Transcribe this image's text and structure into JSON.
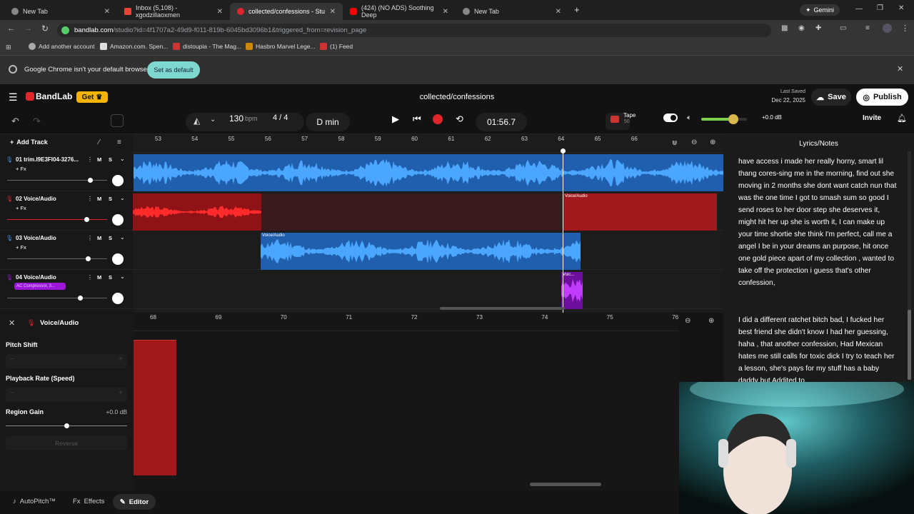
{
  "browser": {
    "tabs": [
      {
        "label": "New Tab",
        "active": false
      },
      {
        "label": "Inbox (5,108) - xgodzillaoxmen",
        "active": false
      },
      {
        "label": "collected/confessions - Stu",
        "active": true
      },
      {
        "label": "(424) (NO ADS) Soothing Deep",
        "active": false
      },
      {
        "label": "New Tab",
        "active": false
      }
    ],
    "gemini_label": "Gemini",
    "url_host": "bandlab.com",
    "url_path": "/studio?id=4f1707a2-49d9-f011-819b-6045bd3096b1&triggered_from=revision_page",
    "bookmarks": [
      "Add another account",
      "Amazon.com. Spen...",
      "distoupia - The Mag...",
      "Hasbro Marvel Lege...",
      "(1) Feed"
    ],
    "infobar_text": "Google Chrome isn't your default browser",
    "set_default_label": "Set as default"
  },
  "header": {
    "logo": "BandLab",
    "get_label": "Get",
    "project_title": "collected/confessions",
    "last_saved_label": "Last Saved",
    "last_saved_date": "Dec 22, 2025",
    "save_label": "Save",
    "publish_label": "Publish"
  },
  "controls": {
    "bpm_value": "130",
    "bpm_unit": "bpm",
    "time_signature": "4 / 4",
    "key": "D min",
    "time_display": "01:56.7",
    "tape_label": "Tape",
    "tape_sub": "50",
    "volume_db": "+0.0 dB",
    "volume_level": 0.7,
    "invite_label": "Invite"
  },
  "tracks_panel": {
    "add_track_label": "Add Track",
    "ruler": [
      "53",
      "54",
      "55",
      "56",
      "57",
      "58",
      "59",
      "60",
      "61",
      "62",
      "63",
      "64",
      "65",
      "66"
    ],
    "tracks": [
      {
        "name": "01  trim.I9E3FI04-3276...",
        "fx": "+ Fx",
        "color": "#3b8ee8",
        "volume": 0.83
      },
      {
        "name": "02  Voice/Audio",
        "fx": "+ Fx",
        "color": "#e0262a",
        "volume": 0.79
      },
      {
        "name": "03  Voice/Audio",
        "fx": "+ Fx",
        "color": "#3b8ee8",
        "volume": 0.81
      },
      {
        "name": "04  Voice/Audio",
        "fx": "AC Compressor, 3...",
        "color": "#9b16d8",
        "volume": 0.73
      }
    ],
    "region_labels": [
      "Voice/Audio",
      "Voice/Audio",
      "Voic..."
    ],
    "mute_solo": "M S"
  },
  "lyrics": {
    "title": "Lyrics/Notes",
    "paragraph1": "have access i made her really horny, smart lil thang cores-sing me in the morning, find out she moving in 2 months she dont want catch nun that was the one time I got to smash sum so good I send roses to her door step she deserves it, might hit her up she is worth it, I can make up your time shortie she think I'm perfect, call me a angel I be in your dreams an purpose, hit once one gold piece apart of my collection , wanted to take off the protection i guess that's other confession,",
    "paragraph2": "I did a different ratchet bitch bad, I fucked her best friend she didn't know I had her guessing, haha , that another confession, Had Mexican hates me still calls for toxic dick I try to teach her a lesson, she's pays for my stuff has a baby daddy but Addited to"
  },
  "editor": {
    "track_name": "Voice/Audio",
    "pitch_shift_label": "Pitch Shift",
    "playback_rate_label": "Playback Rate (Speed)",
    "region_gain_label": "Region Gain",
    "region_gain_value": "+0.0 dB",
    "region_gain_level": 0.5,
    "reverse_label": "Reverse",
    "ruler": [
      "68",
      "69",
      "70",
      "71",
      "72",
      "73",
      "74",
      "75",
      "76"
    ]
  },
  "bottom_tabs": {
    "autopitch_label": "AutoPitch™",
    "effects_label": "Effects",
    "editor_label": "Editor"
  },
  "colors": {
    "accent_yellow": "#f4b400",
    "track_blue": "#3b8ee8",
    "track_red": "#e0262a",
    "track_purple": "#9b16d8",
    "set_default_bg": "#7fd8d0"
  }
}
